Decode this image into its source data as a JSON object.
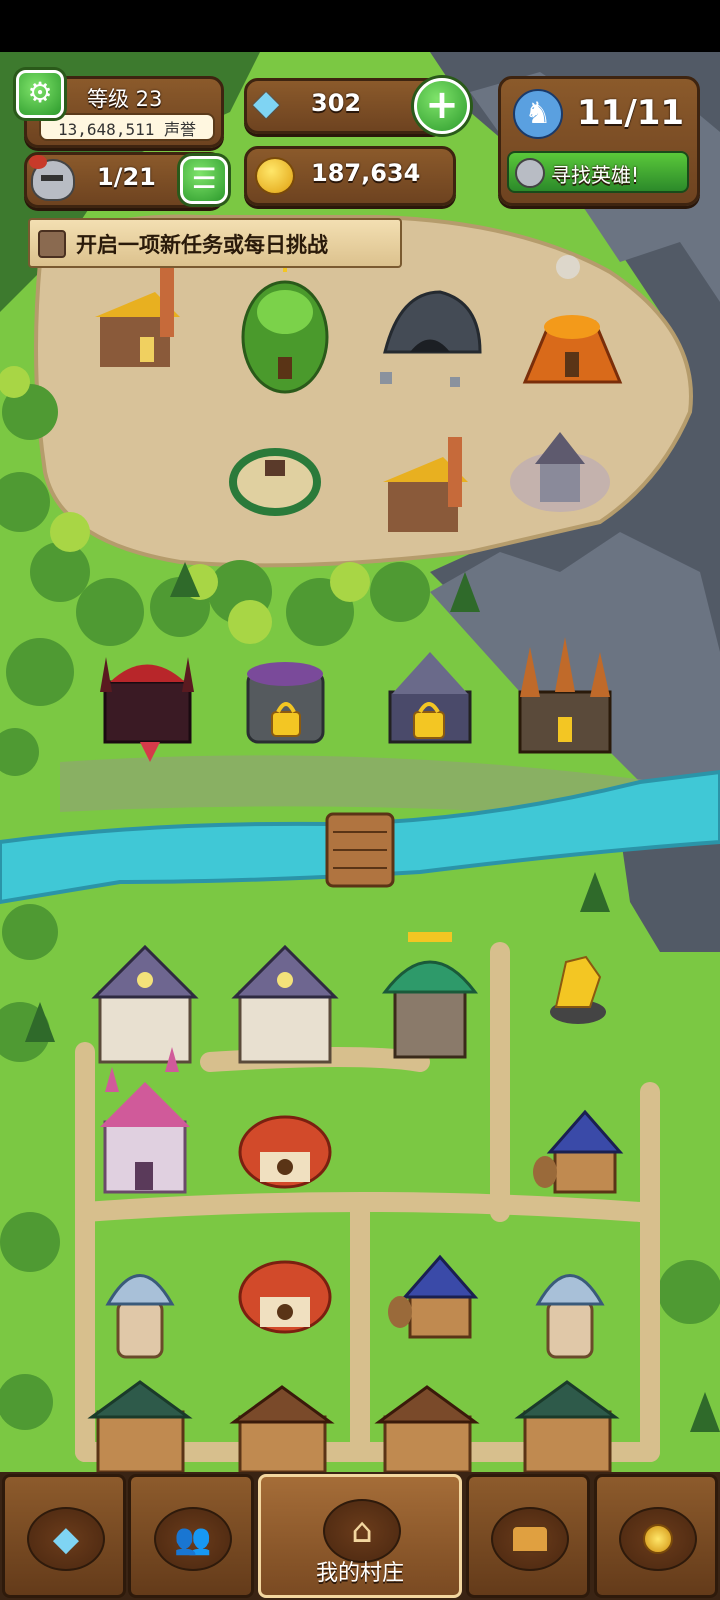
{
  "hud": {
    "level_label": "等级 23",
    "reputation": "13,648,511 声誉",
    "gems": "302",
    "gold": "187,634",
    "heroes": "11/11",
    "find_heroes": "寻找英雄!",
    "units": "1/21",
    "quest_banner": "开启一项新任务或每日挑战"
  },
  "bottom_nav": {
    "tabs": [
      {
        "icon": "diamond-icon"
      },
      {
        "icon": "people-icon"
      },
      {
        "icon": "house-icon",
        "label": "我的村庄",
        "active": true
      },
      {
        "icon": "treasure-chest-icon"
      },
      {
        "icon": "medal-icon"
      }
    ]
  },
  "colors": {
    "grass": "#7bc843",
    "dirt": "#d8c299",
    "river": "#40c8d6",
    "wood": "#7a4a22",
    "accent_green": "#3fb83f",
    "gold": "#f3c623"
  }
}
